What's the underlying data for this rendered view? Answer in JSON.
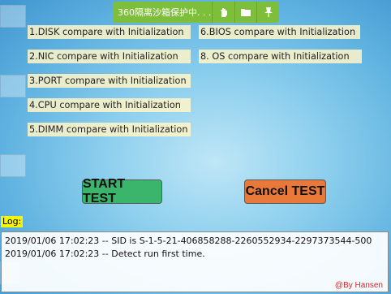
{
  "sandbox_bar": {
    "title": "360隔离沙箱保护中. . .",
    "buttons": [
      "hand-icon",
      "folder-icon",
      "pin-icon"
    ],
    "accent": "#7dbf3a"
  },
  "items": {
    "disk": "1.DISK  compare with Initialization",
    "nic": "2.NIC   compare with Initialization",
    "port": "3.PORT   compare with Initialization",
    "cpu": "4.CPU  compare with Initialization",
    "dimm": "5.DIMM compare with Initialization",
    "bios": "6.BIOS  compare with Initialization",
    "os": "8. OS compare with Initialization"
  },
  "buttons": {
    "start": "START TEST",
    "cancel": "Cancel TEST",
    "start_color": "#3bb46c",
    "cancel_color": "#e9793a"
  },
  "log": {
    "label": "Log:",
    "lines": [
      "2019/01/06 17:02:23 -- SID is S-1-5-21-406858288-2260552934-2297373544-500",
      "2019/01/06 17:02:23 -- Detect run first time."
    ],
    "watermark": "@By Hansen"
  }
}
